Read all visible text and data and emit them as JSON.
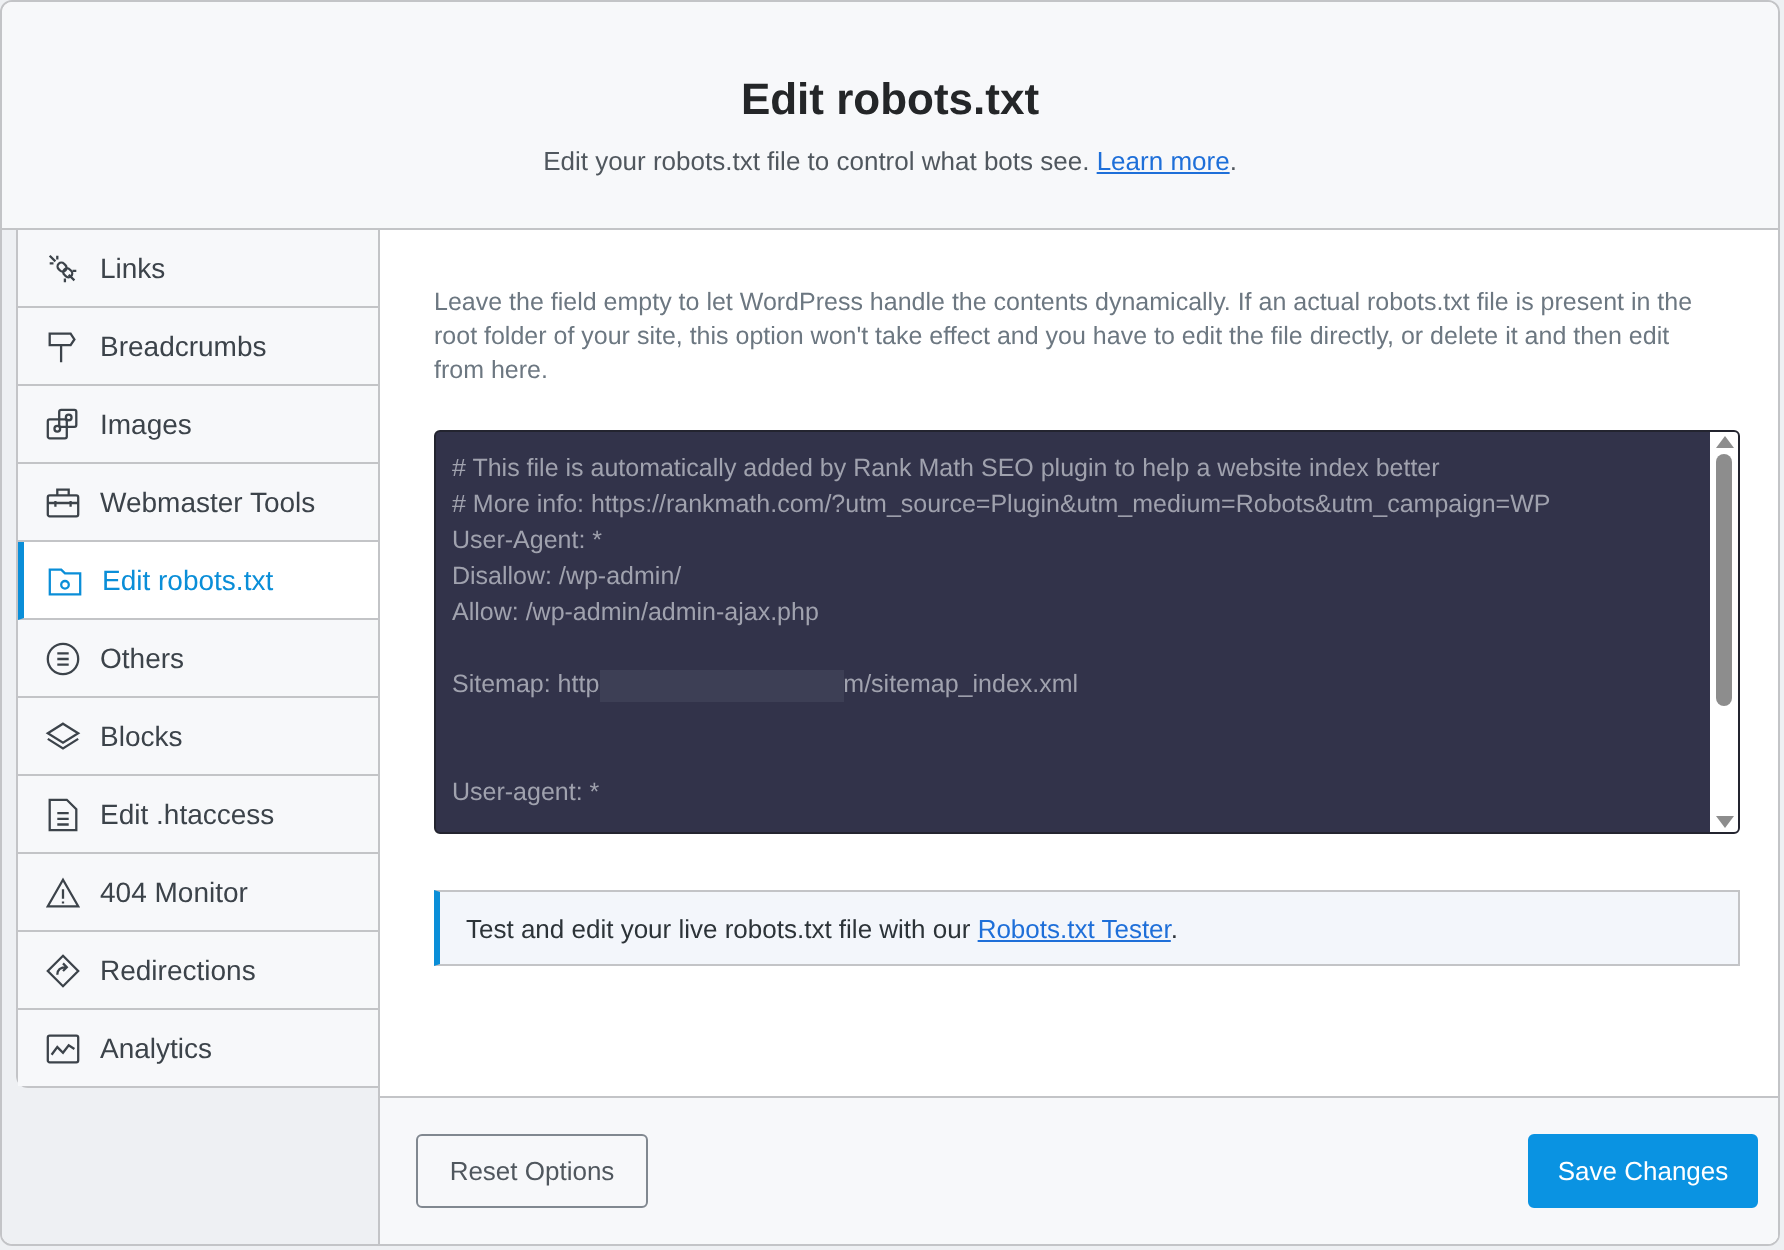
{
  "header": {
    "title": "Edit robots.txt",
    "subtitle": "Edit your robots.txt file to control what bots see.",
    "link": "Learn more",
    "after_link": "."
  },
  "sidebar": {
    "items": [
      {
        "label": "Links",
        "selected": false
      },
      {
        "label": "Breadcrumbs",
        "selected": false
      },
      {
        "label": "Images",
        "selected": false
      },
      {
        "label": "Webmaster Tools",
        "selected": false
      },
      {
        "label": "Edit robots.txt",
        "selected": true
      },
      {
        "label": "Others",
        "selected": false
      },
      {
        "label": "Blocks",
        "selected": false
      },
      {
        "label": "Edit .htaccess",
        "selected": false
      },
      {
        "label": "404 Monitor",
        "selected": false
      },
      {
        "label": "Redirections",
        "selected": false
      },
      {
        "label": "Analytics",
        "selected": false
      }
    ]
  },
  "description": "Leave the field empty to let WordPress handle the contents dynamically. If an actual robots.txt file is present in the root folder of your site, this option won't take effect and you have to edit the file directly, or delete it and then edit from here.",
  "editor": {
    "lines": [
      {
        "kind": "text",
        "text": "# This file is automatically added by Rank Math SEO plugin to help a website index better"
      },
      {
        "kind": "text",
        "text": "# More info: https://rankmath.com/?utm_source=Plugin&utm_medium=Robots&utm_campaign=WP"
      },
      {
        "kind": "text",
        "text": "User-Agent: *"
      },
      {
        "kind": "text",
        "text": "Disallow: /wp-admin/"
      },
      {
        "kind": "text",
        "text": "Allow: /wp-admin/admin-ajax.php"
      },
      {
        "kind": "blank"
      },
      {
        "kind": "redacted",
        "before": "Sitemap: http",
        "after": "m/sitemap_index.xml"
      },
      {
        "kind": "blank"
      },
      {
        "kind": "blank"
      },
      {
        "kind": "text",
        "text": "User-agent: *"
      }
    ]
  },
  "notice": {
    "text": "Test and edit your live robots.txt file with our",
    "link": "Robots.txt Tester",
    "after_link": "."
  },
  "footer": {
    "reset": "Reset Options",
    "save": "Save Changes"
  }
}
